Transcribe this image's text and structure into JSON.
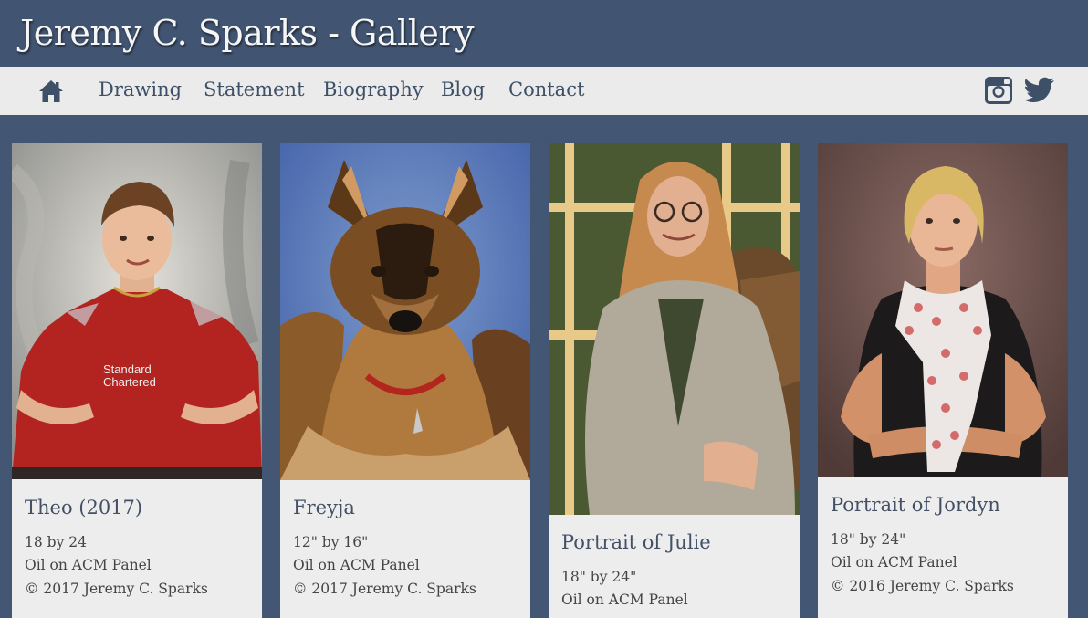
{
  "header": {
    "title": "Jeremy C. Sparks - Gallery"
  },
  "nav": {
    "home_icon": "home-icon",
    "items": [
      "Drawing",
      "Statement",
      "Biography",
      "Blog",
      "Contact"
    ],
    "social": [
      "instagram-icon",
      "twitter-icon"
    ]
  },
  "gallery": [
    {
      "title": "Theo (2017)",
      "size": "18 by 24",
      "medium": "Oil on ACM Panel",
      "copyright": "© 2017 Jeremy C. Sparks"
    },
    {
      "title": "Freyja",
      "size": "12\" by 16\"",
      "medium": "Oil on ACM Panel",
      "copyright": "© 2017 Jeremy C. Sparks"
    },
    {
      "title": "Portrait of Julie",
      "size": "18\" by 24\"",
      "medium": "Oil on ACM Panel",
      "copyright": ""
    },
    {
      "title": "Portrait of Jordyn",
      "size": "18\" by 24\"",
      "medium": "Oil on ACM Panel",
      "copyright": "© 2016 Jeremy C. Sparks"
    }
  ],
  "colors": {
    "header_bg": "#415471",
    "page_bg": "#435673",
    "nav_bg": "#ebebeb",
    "nav_text": "#3e5068",
    "card_bg": "#ededed"
  }
}
